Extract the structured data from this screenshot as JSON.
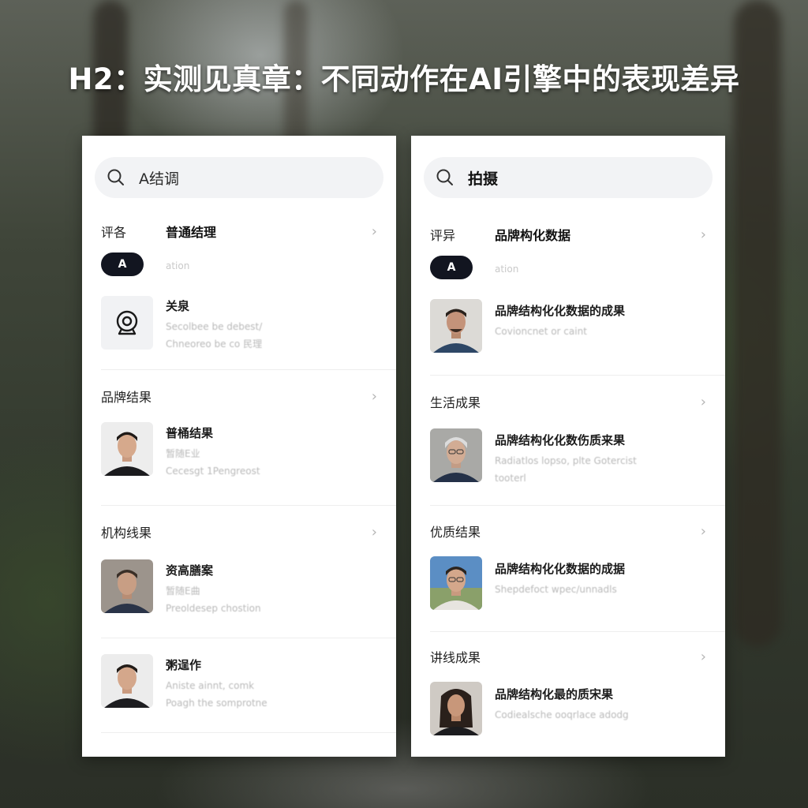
{
  "headline": "H2：实测见真章：不同动作在AI引擎中的表现差异",
  "left": {
    "search": {
      "text": "A结调",
      "icon": "search-icon"
    },
    "header": {
      "label": "评各",
      "title": "普通结理"
    },
    "pill": {
      "label": "A",
      "text": "ation"
    },
    "first_item": {
      "title": "关泉",
      "sub1": "Secolbee be debest/",
      "sub2": "Chneoreo be co 民理",
      "icon": "webcam-icon"
    },
    "sections": [
      {
        "label": "品牌结果",
        "item": {
          "title": "普桶结果",
          "sub1": "暂随E业",
          "sub2": "Cecesgt 1Pengreost"
        }
      },
      {
        "label": "机构线果",
        "item": {
          "title": "资高膳案",
          "sub1": "暂随E曲",
          "sub2": "Preoldesep chostion"
        }
      },
      {
        "label": "",
        "item": {
          "title": "粥逞作",
          "sub1": "Aniste ainnt, comk",
          "sub2": "Poagh the somprotne"
        }
      }
    ]
  },
  "right": {
    "search": {
      "text": "拍摄",
      "icon": "search-icon"
    },
    "header": {
      "label": "评异",
      "title": "品牌构化数据"
    },
    "pill": {
      "label": "A",
      "text": "ation"
    },
    "first_item": {
      "title": "品牌结构化化数据的成果",
      "sub1": "Covioncnet or caint",
      "sub2": ""
    },
    "sections": [
      {
        "label": "生活成果",
        "item": {
          "title": "品牌结构化化数伤质来果",
          "sub1": "Radiatlos lopso, plte Gotercist",
          "sub2": "tooterl"
        }
      },
      {
        "label": "优质结果",
        "item": {
          "title": "品牌结构化化数据的成据",
          "sub1": "Shepdefoct wpec/unnadls",
          "sub2": ""
        }
      },
      {
        "label": "讲线成果",
        "item": {
          "title": "品牌结构化最的质宋果",
          "sub1": "Codiealsche ooqrlace adodg",
          "sub2": ""
        }
      }
    ]
  },
  "colors": {
    "pill_bg": "#121520",
    "panel_bg": "#ffffff",
    "search_bg": "#f2f3f5",
    "chevron": "#b5b5b5"
  }
}
